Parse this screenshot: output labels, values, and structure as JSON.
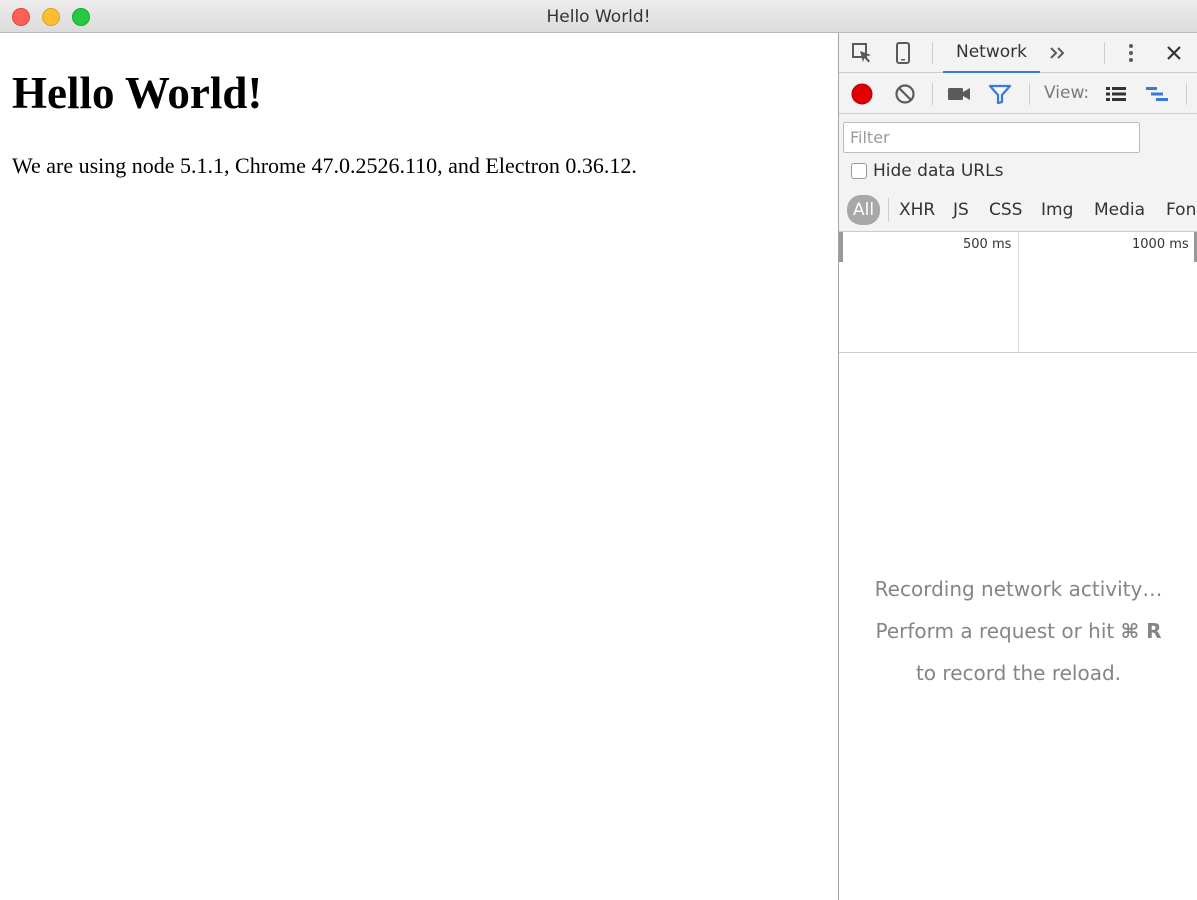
{
  "window": {
    "title": "Hello World!"
  },
  "page": {
    "heading": "Hello World!",
    "text": "We are using node 5.1.1, Chrome 47.0.2526.110, and Electron 0.36.12."
  },
  "devtools": {
    "active_tab": "Network",
    "view_label": "View:",
    "filter_placeholder": "Filter",
    "hide_data_urls_label": "Hide data URLs",
    "hide_data_urls_checked": false,
    "type_filters": [
      "All",
      "XHR",
      "JS",
      "CSS",
      "Img",
      "Media",
      "Fon"
    ],
    "active_type_filter": "All",
    "timeline_labels": [
      "500 ms",
      "1000 ms"
    ],
    "empty_line1": "Recording network activity…",
    "empty_line2_prefix": "Perform a request or hit ",
    "empty_line2_keys": "⌘ R",
    "empty_line3": "to record the reload.",
    "colors": {
      "record": "#e00000",
      "accent": "#3879d9"
    },
    "icons": [
      "inspect-element-icon",
      "device-mode-icon",
      "more-tabs-icon",
      "kebab-menu-icon",
      "close-icon",
      "record-icon",
      "clear-icon",
      "screenshot-camera-icon",
      "filter-icon",
      "large-rows-icon",
      "waterfall-overview-icon"
    ]
  }
}
